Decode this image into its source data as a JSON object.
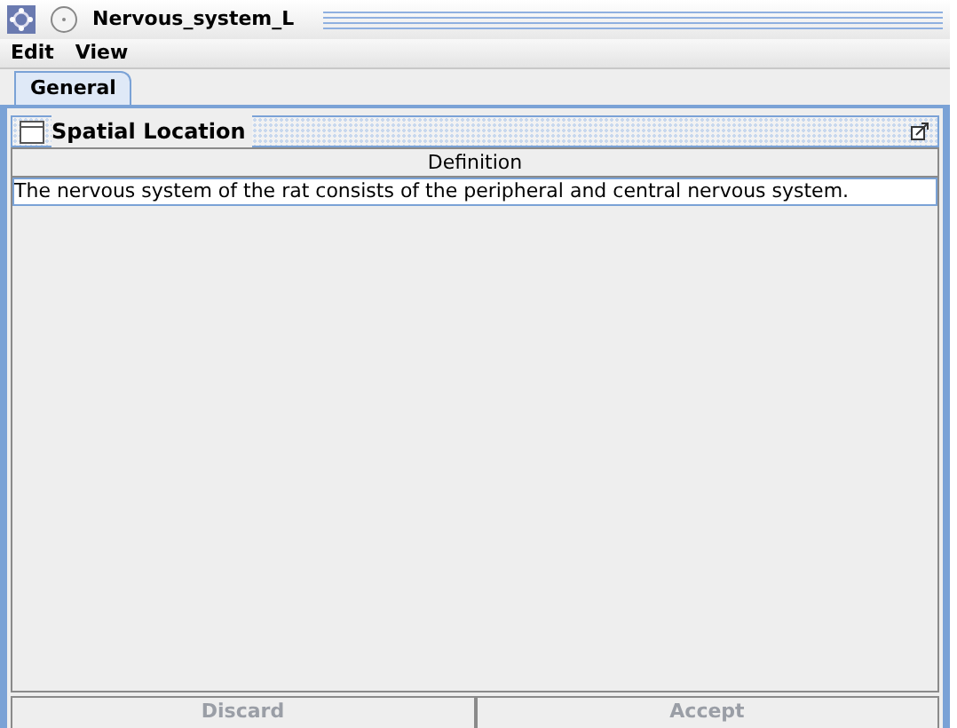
{
  "window": {
    "title": "Nervous_system_L"
  },
  "menu": [
    "Edit",
    "View"
  ],
  "tabs": [
    {
      "label": "General",
      "selected": true
    }
  ],
  "panel": {
    "title": "Spatial Location"
  },
  "table": {
    "columns": [
      "Definition"
    ],
    "rows": [
      {
        "cells": [
          "The nervous system of the rat consists of the peripheral and central nervous system."
        ],
        "selected": true
      }
    ]
  },
  "buttons": [
    {
      "label": "Discard",
      "disabled": true
    },
    {
      "label": "Accept",
      "disabled": true
    }
  ]
}
